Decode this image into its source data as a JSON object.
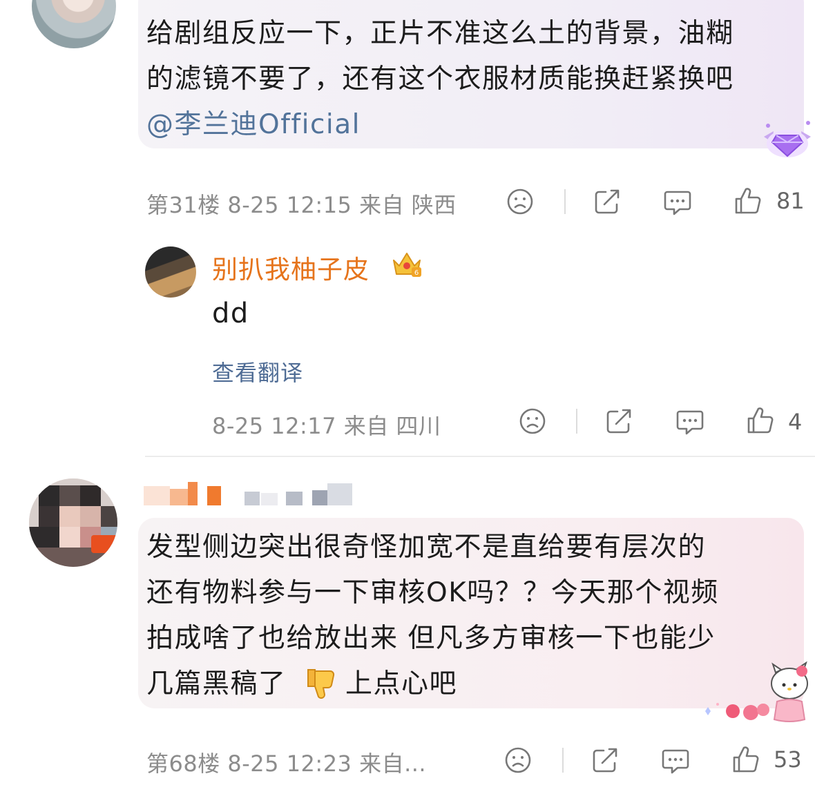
{
  "comments": [
    {
      "text_line1": "给剧组反应一下，正片不准这么土的背景，油糊",
      "text_line2": "的滤镜不要了，还有这个衣服材质能换赶紧换吧",
      "mention": "@李兰迪Official",
      "meta": "第31楼 8-25 12:15 来自 陕西",
      "likes": "81"
    },
    {
      "username": "别扒我柚子皮",
      "text": "dd",
      "translate_label": "查看翻译",
      "meta": "8-25 12:17 来自 四川",
      "likes": "4"
    },
    {
      "text_line1": "发型侧边突出很奇怪加宽不是直给要有层次的",
      "text_line2": "还有物料参与一下审核OK吗？？今天那个视频",
      "text_line3": "拍成啥了也给放出来 但凡多方审核一下也能少",
      "text_line4_a": "几篇黑稿了",
      "text_line4_b": "上点心吧",
      "meta": "第68楼 8-25 12:23 来自...",
      "likes": "53"
    }
  ],
  "icons": [
    "dislike-face-icon",
    "share-icon",
    "reply-icon",
    "thumbs-up-icon",
    "crown-badge-icon",
    "diamond-badge-icon",
    "thumbs-down-emoji-icon",
    "hello-kitty-decoration-icon"
  ],
  "colors": {
    "username": "#e6741c",
    "mention": "#52739a",
    "meta": "#8c8c8c"
  }
}
